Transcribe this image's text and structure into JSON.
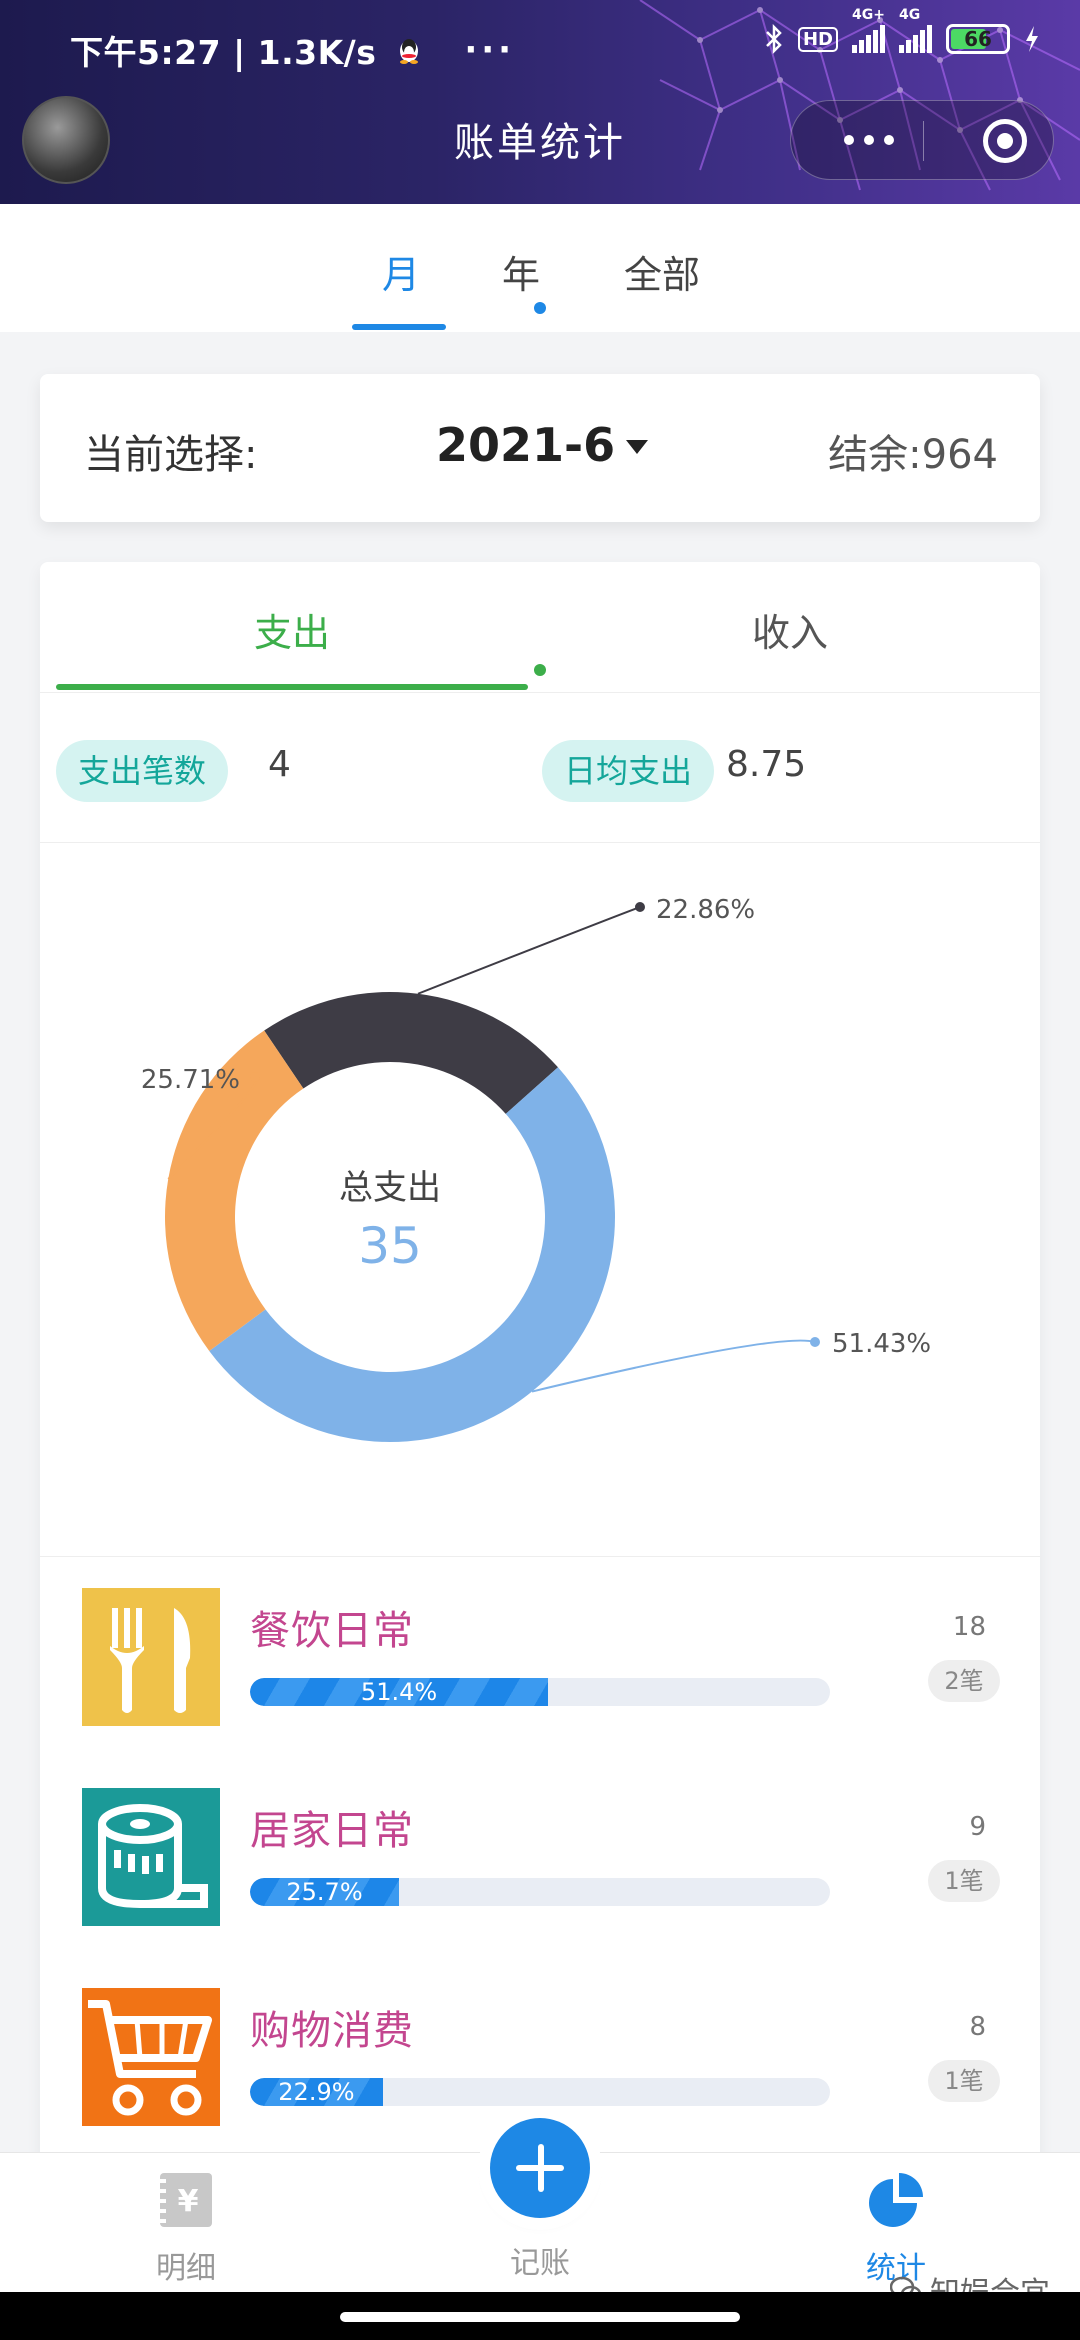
{
  "status_bar": {
    "time_speed": "下午5:27 | 1.3K/s",
    "more": "···",
    "hd": "HD",
    "net1": "4G+",
    "net2": "4G",
    "battery": "66"
  },
  "header": {
    "title": "账单统计"
  },
  "period_tabs": [
    {
      "label": "月",
      "active": true
    },
    {
      "label": "年",
      "active": false
    },
    {
      "label": "全部",
      "active": false
    }
  ],
  "selection": {
    "label": "当前选择:",
    "value": "2021-6",
    "balance_label": "结余:",
    "balance_value": "964"
  },
  "io_tabs": {
    "expense": "支出",
    "income": "收入"
  },
  "stats": {
    "count_label": "支出笔数",
    "count_value": "4",
    "daily_label": "日均支出",
    "daily_value": "8.75"
  },
  "chart_data": {
    "type": "pie",
    "center_label": "总支出",
    "center_value": "35",
    "slices": [
      {
        "category": "餐饮日常",
        "percent": 51.43,
        "label": "51.43%",
        "color": "#7fb2e8"
      },
      {
        "category": "居家日常",
        "percent": 25.71,
        "label": "25.71%",
        "color": "#f5a75b"
      },
      {
        "category": "购物消费",
        "percent": 22.86,
        "label": "22.86%",
        "color": "#3e3c45"
      }
    ]
  },
  "categories": [
    {
      "name": "餐饮日常",
      "percent": 51.4,
      "percent_label": "51.4%",
      "amount": "18",
      "count": "2笔",
      "icon": "fork-knife-icon",
      "color": "#efc24a"
    },
    {
      "name": "居家日常",
      "percent": 25.7,
      "percent_label": "25.7%",
      "amount": "9",
      "count": "1笔",
      "icon": "tissue-roll-icon",
      "color": "#1b9a98"
    },
    {
      "name": "购物消费",
      "percent": 22.9,
      "percent_label": "22.9%",
      "amount": "8",
      "count": "1笔",
      "icon": "shopping-cart-icon",
      "color": "#f17315"
    }
  ],
  "bottom_nav": {
    "detail": "明细",
    "record": "记账",
    "stats": "统计"
  },
  "watermark": "知娱合宜"
}
